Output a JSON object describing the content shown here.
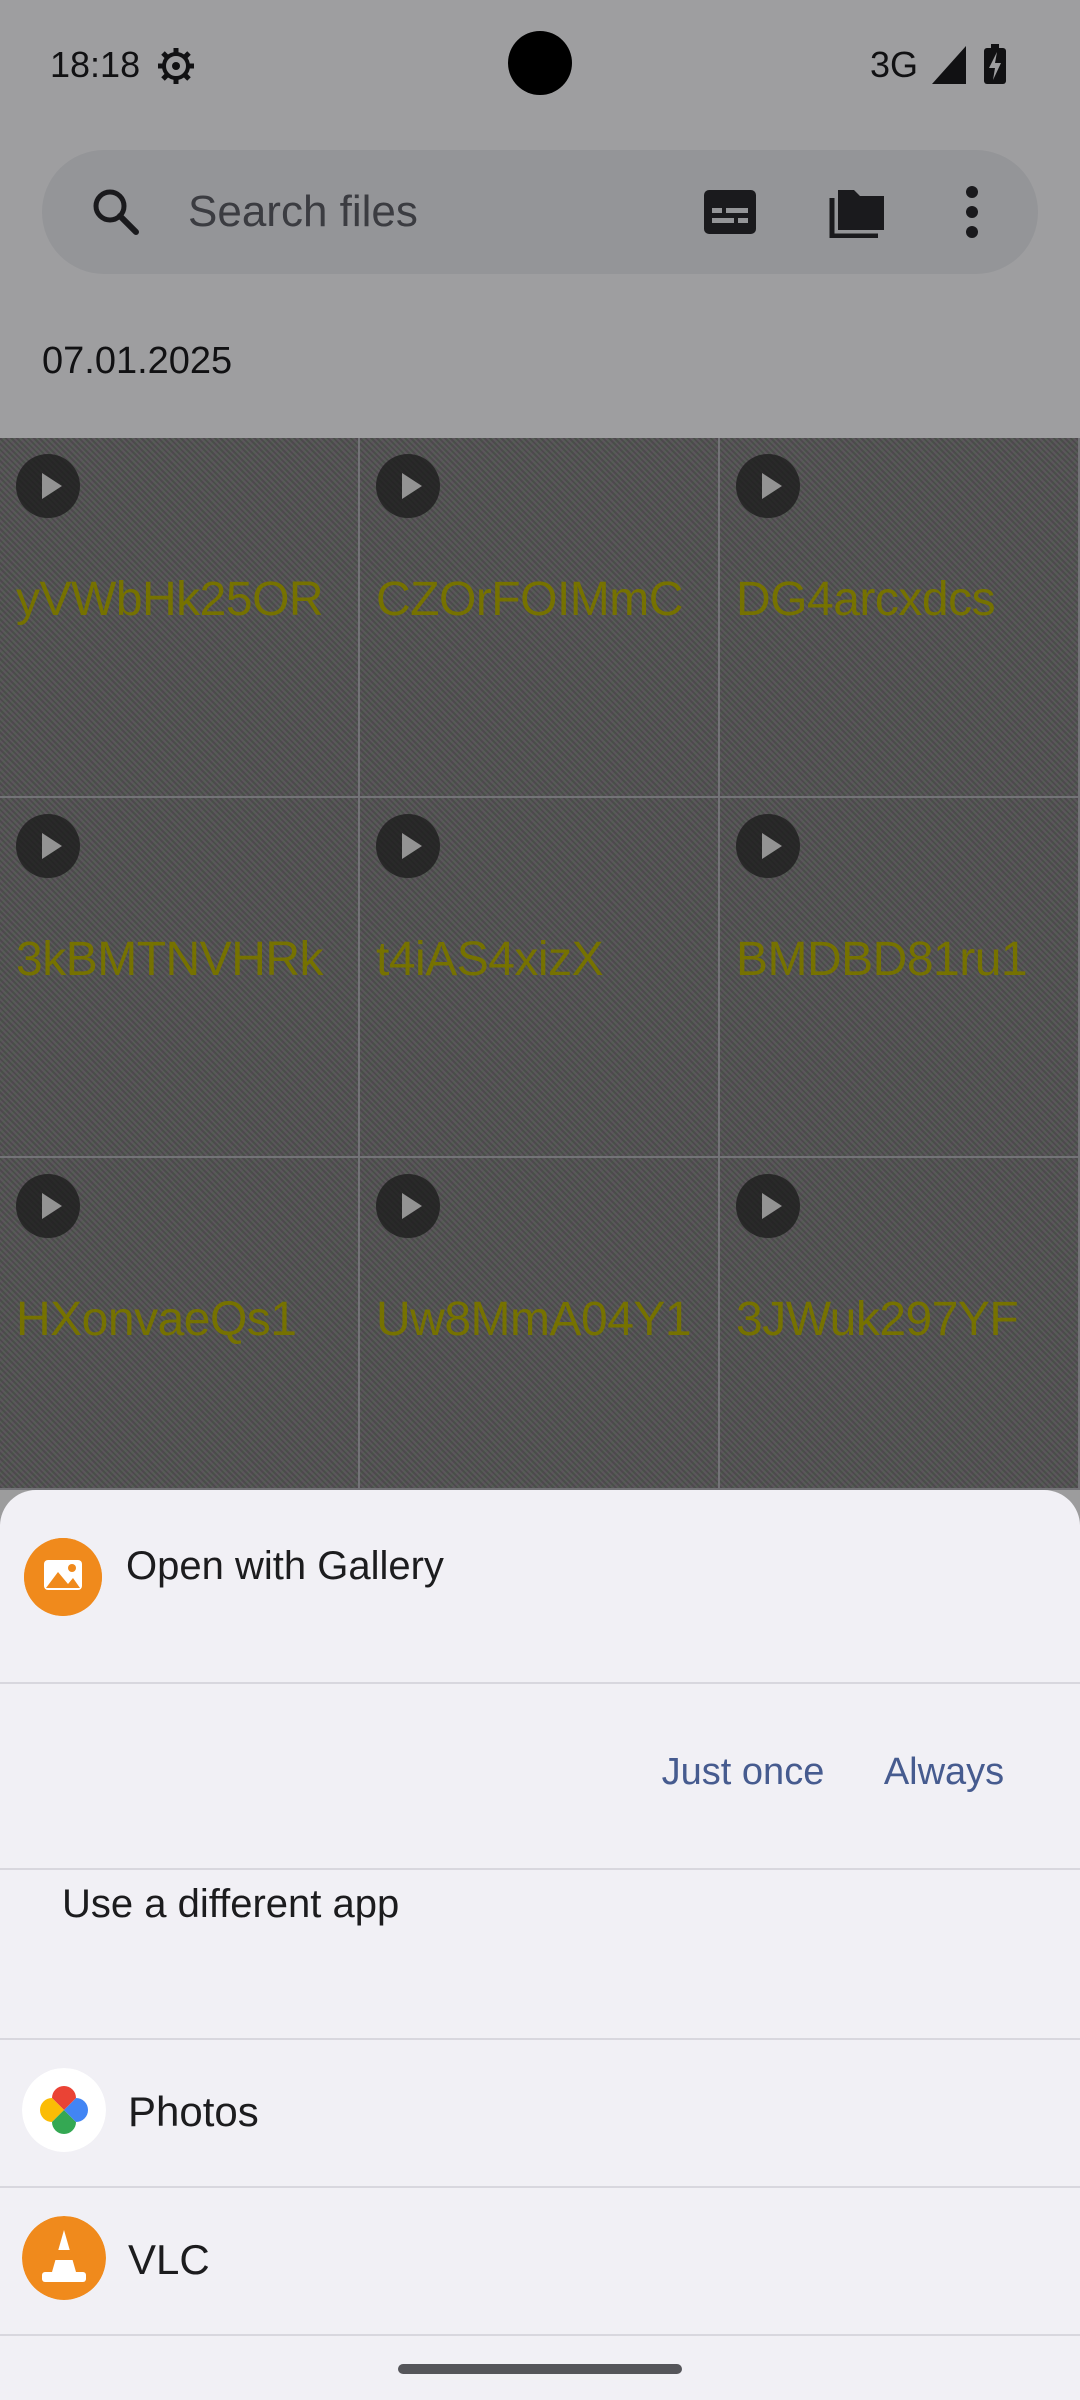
{
  "status_bar": {
    "time": "18:18",
    "network": "3G",
    "icons": [
      "settings-gear-icon",
      "signal-icon",
      "battery-charging-icon"
    ]
  },
  "search": {
    "placeholder": "Search files",
    "icons": [
      "search-icon",
      "subtitles-icon",
      "folder-icon",
      "more-vert-icon"
    ]
  },
  "date_header": "07.01.2025",
  "files": [
    {
      "name": "yVWbHk25OR"
    },
    {
      "name": "CZOrFOIMmC"
    },
    {
      "name": "DG4arcxdcs"
    },
    {
      "name": "3kBMTNVHRk"
    },
    {
      "name": "t4iAS4xizX"
    },
    {
      "name": "BMDBD81ru1"
    },
    {
      "name": "HXonvaeQs1"
    },
    {
      "name": "Uw8MmA04Y1"
    },
    {
      "name": "3JWuk297YF"
    }
  ],
  "colors": {
    "accent_text": "#465b8f",
    "file_name_text": "#b9b300",
    "sheet_background": "#f1f0f5"
  },
  "sheet": {
    "open_with_title": "Open with Gallery",
    "just_once_label": "Just once",
    "always_label": "Always",
    "different_app_label": "Use a different app",
    "apps": [
      {
        "label": "Photos",
        "icon": "google-photos-icon"
      },
      {
        "label": "VLC",
        "icon": "vlc-cone-icon"
      }
    ]
  }
}
